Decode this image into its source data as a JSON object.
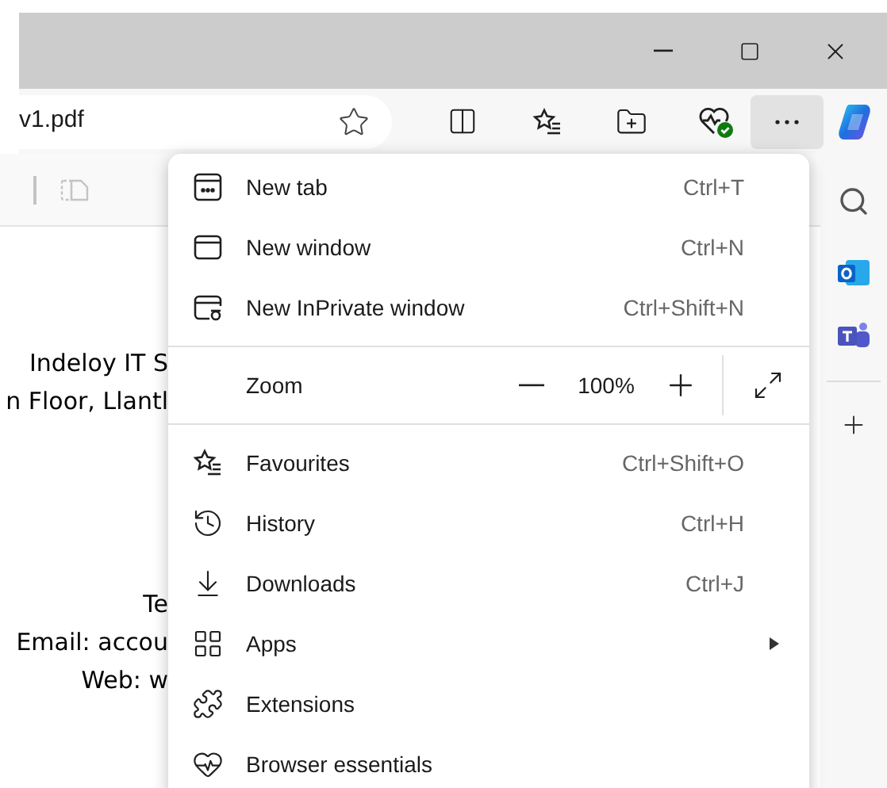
{
  "address_bar": {
    "text": "v1.pdf"
  },
  "document_lines": [
    {
      "text": "Indeloy IT S"
    },
    {
      "text": "n Floor, Llantl"
    },
    {
      "text": "Te"
    },
    {
      "text": "Email: accou"
    },
    {
      "text": "Web: w"
    }
  ],
  "toolbar": {
    "more_selected": true
  },
  "menu": [
    {
      "kind": "item",
      "label": "New tab",
      "shortcut": "Ctrl+T"
    },
    {
      "kind": "item",
      "label": "New window",
      "shortcut": "Ctrl+N"
    },
    {
      "kind": "item",
      "label": "New InPrivate window",
      "shortcut": "Ctrl+Shift+N"
    },
    {
      "kind": "divider"
    },
    {
      "kind": "zoom",
      "label": "Zoom",
      "value": "100%"
    },
    {
      "kind": "divider"
    },
    {
      "kind": "item",
      "label": "Favourites",
      "shortcut": "Ctrl+Shift+O"
    },
    {
      "kind": "item",
      "label": "History",
      "shortcut": "Ctrl+H"
    },
    {
      "kind": "item",
      "label": "Downloads",
      "shortcut": "Ctrl+J"
    },
    {
      "kind": "item",
      "label": "Apps",
      "submenu": true
    },
    {
      "kind": "item",
      "label": "Extensions"
    },
    {
      "kind": "item",
      "label": "Browser essentials"
    }
  ]
}
